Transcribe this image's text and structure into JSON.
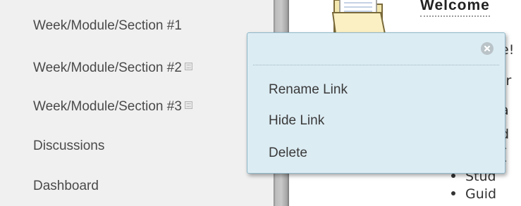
{
  "sidebar": {
    "items": [
      {
        "label": "Week/Module/Section #1",
        "has_menu": false
      },
      {
        "label": "Week/Module/Section #2",
        "has_menu": true
      },
      {
        "label": "Week/Module/Section #3",
        "has_menu": true
      },
      {
        "label": "Discussions",
        "has_menu": false
      },
      {
        "label": "Dashboard",
        "has_menu": false
      }
    ]
  },
  "content": {
    "heading": "Welcome",
    "fragments": [
      "e!",
      "tr",
      "a",
      "d",
      "r",
      "r"
    ],
    "bullets": [
      "Stud",
      "Guid"
    ]
  },
  "context_menu": {
    "items": [
      "Rename Link",
      "Hide Link",
      "Delete"
    ],
    "close_icon": "close-icon"
  }
}
